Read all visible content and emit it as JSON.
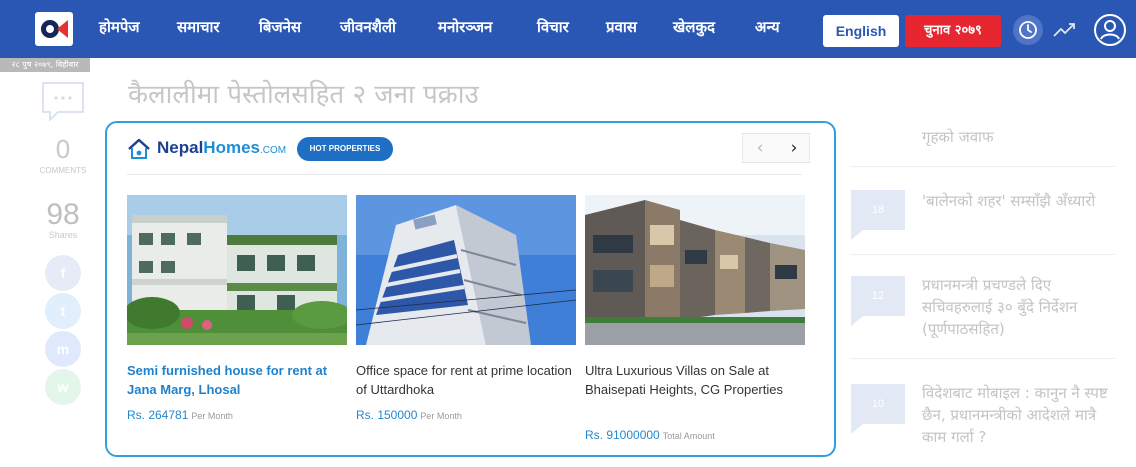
{
  "nav": {
    "logo_alt": "OK",
    "items": [
      "होमपेज",
      "समाचार",
      "बिजनेस",
      "जीवनशैली",
      "मनोरञ्जन",
      "विचार",
      "प्रवास",
      "खेलकुद",
      "अन्य"
    ],
    "english_label": "English",
    "election_label": "चुनाव २०७९"
  },
  "sidebar": {
    "date": "२८ पुष २०७९, बिहीबार",
    "comment_count": "0",
    "comment_label": "COMMENTS",
    "share_count": "98",
    "share_label": "Shares",
    "social": [
      {
        "icon": "facebook-icon",
        "glyph": "f",
        "color": "#e6ecf7"
      },
      {
        "icon": "twitter-icon",
        "glyph": "t",
        "color": "#e1eefb"
      },
      {
        "icon": "messenger-icon",
        "glyph": "m",
        "color": "#dfe9fb"
      },
      {
        "icon": "whatsapp-icon",
        "glyph": "w",
        "color": "#e4f6ea"
      }
    ]
  },
  "article": {
    "title": "कैलालीमा पेस्तोलसहित २ जना पक्राउ"
  },
  "ad": {
    "brand_main": "Nepal",
    "brand_accent": "Homes",
    "brand_suffix": ".COM",
    "badge": "HOT PROPERTIES",
    "prev_arrow": "‹",
    "next_arrow": "›",
    "listings": [
      {
        "title": "Semi furnished house for rent at Jana Marg, Lhosal",
        "price": "Rs. 264781",
        "unit": "Per Month",
        "title_color": "#1f82cc"
      },
      {
        "title": "Office space for rent at prime location of Uttardhoka",
        "price": "Rs. 150000",
        "unit": "Per Month",
        "title_color": "#333333"
      },
      {
        "title": "Ultra Luxurious Villas on Sale at Bhaisepati Heights, CG Properties",
        "price": "Rs. 91000000",
        "unit": "Total Amount",
        "title_color": "#333333"
      }
    ]
  },
  "trending": [
    {
      "rank": "",
      "text": "गृहको जवाफ"
    },
    {
      "rank": "18",
      "text": "'बालेनको शहर' सम्साँझै अँध्यारो"
    },
    {
      "rank": "12",
      "text": "प्रधानमन्त्री प्रचण्डले दिए सचिवहरुलाई ३० बुँदे निर्देशन (पूर्णपाठसहित)"
    },
    {
      "rank": "10",
      "text": "विदेशबाट मोबाइल : कानुन नै स्पष्ट छैन, प्रधानमन्त्रीको आदेशले मात्रै काम गर्ला ?"
    }
  ]
}
